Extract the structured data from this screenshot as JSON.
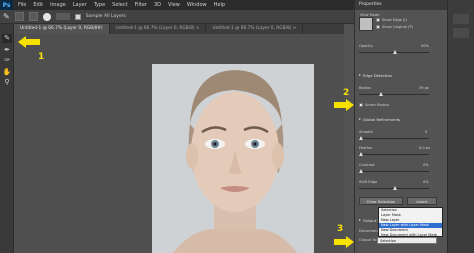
{
  "menubar": {
    "logo": "Ps",
    "items": [
      "File",
      "Edit",
      "Image",
      "Layer",
      "Type",
      "Select",
      "Filter",
      "3D",
      "View",
      "Window",
      "Help"
    ]
  },
  "options": {
    "sample_label": "Sample All Layers"
  },
  "tabs": [
    {
      "label": "Untitled-1 @ 66.7% (Layer 0, RGB/8#)",
      "active": false
    },
    {
      "label": "Untitled-1 @ 66.7% (Layer 0, RGB/8) ×",
      "active": true
    },
    {
      "label": "Untitled-1 @ 66.7% (Layer 0, RGB/8) ×",
      "active": false
    }
  ],
  "tools": [
    "brush",
    "quick-selection",
    "refine-radius",
    "hand",
    "zoom"
  ],
  "properties": {
    "title": "Properties",
    "view_mode": "View Mode",
    "show_edge": "Show Edge (J)",
    "show_original": "Show Original (P)",
    "opacity_label": "Opacity",
    "opacity_value": "50%",
    "edge_detection": "Edge Detection",
    "radius_label": "Radius",
    "radius_value": "39 px",
    "smart_radius": "Smart Radius",
    "global_refinements": "Global Refinements",
    "smooth_label": "Smooth",
    "smooth_value": "0",
    "feather_label": "Feather",
    "feather_value": "0.0 px",
    "contrast_label": "Contrast",
    "contrast_value": "0%",
    "shift_edge_label": "Shift Edge",
    "shift_edge_value": "0%",
    "clear_selection": "Clear Selection",
    "invert": "Invert",
    "output_settings": "Output Settings",
    "decontaminate": "Decontaminate Colors",
    "output_to_label": "Output To",
    "output_to_value": "Selection"
  },
  "dropdown": {
    "options": [
      "Selection",
      "Layer Mask",
      "New Layer",
      "New Layer with Layer Mask",
      "New Document",
      "New Document with Layer Mask"
    ],
    "highlighted": "New Layer with Layer Mask"
  },
  "annotations": [
    "1",
    "2",
    "3"
  ],
  "colors": {
    "accent": "#f7e100",
    "panel": "#535353",
    "menubar": "#2b2b2b",
    "highlight": "#2f6fd0"
  }
}
